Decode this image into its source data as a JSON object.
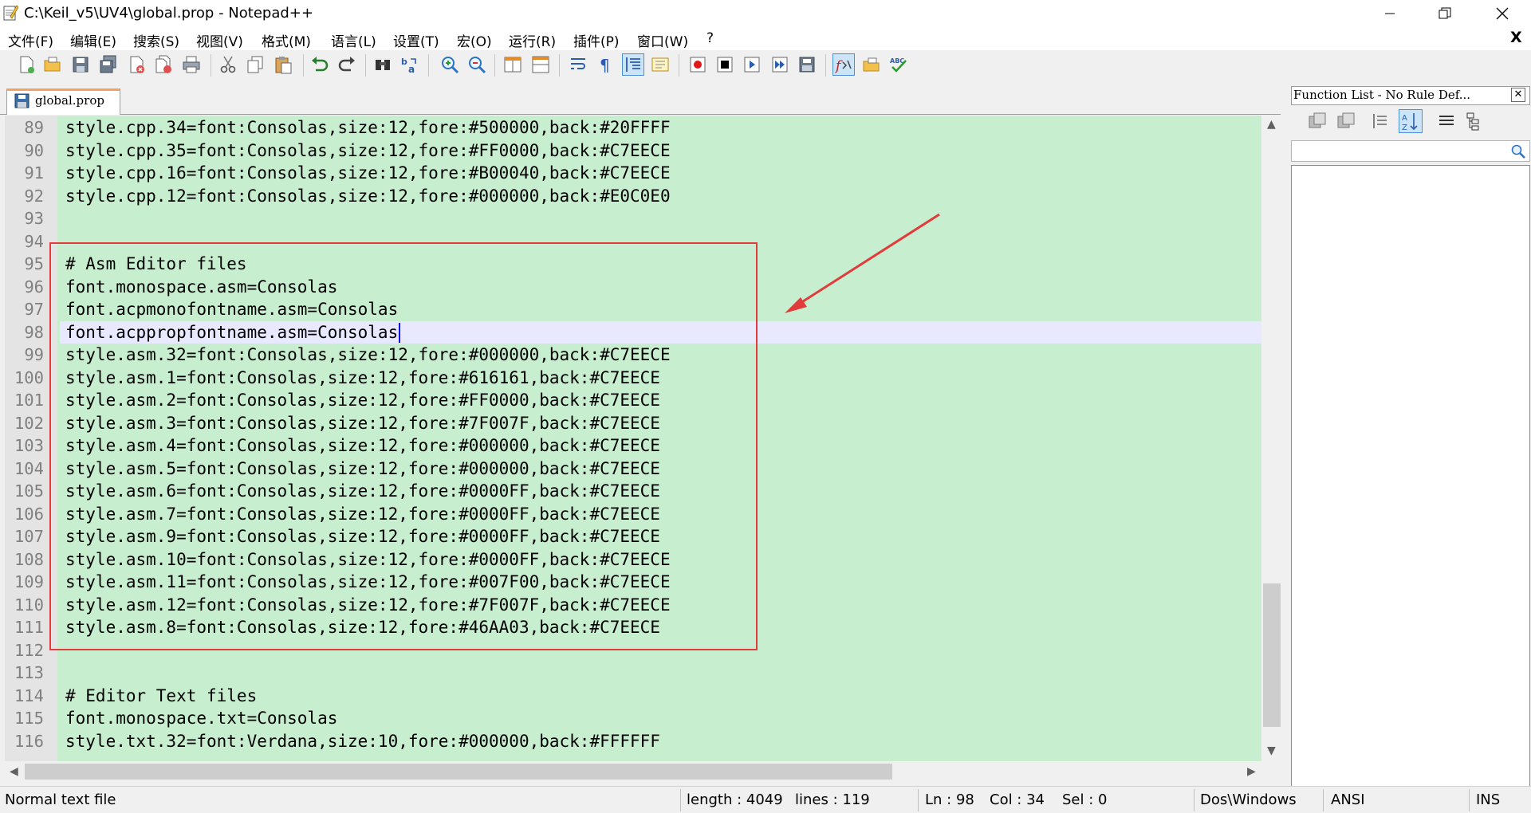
{
  "window": {
    "title": "C:\\Keil_v5\\UV4\\global.prop - Notepad++",
    "minimize_icon": "minimize-icon",
    "maximize_icon": "restore-icon",
    "close_icon": "close-icon"
  },
  "menu": {
    "items": [
      "文件(F)",
      "编辑(E)",
      "搜索(S)",
      "视图(V)",
      "格式(M)",
      "语言(L)",
      "设置(T)",
      "宏(O)",
      "运行(R)",
      "插件(P)",
      "窗口(W)",
      "?"
    ],
    "close_doc": "X"
  },
  "toolbar": {
    "icons": [
      "new-file-icon",
      "open-file-icon",
      "save-icon",
      "save-all-icon",
      "close-icon",
      "close-all-icon",
      "print-icon",
      "cut-icon",
      "copy-icon",
      "paste-icon",
      "undo-icon",
      "redo-icon",
      "find-icon",
      "replace-icon",
      "zoom-in-icon",
      "zoom-out-icon",
      "sync-vertical-icon",
      "sync-horizontal-icon",
      "word-wrap-icon",
      "show-all-chars-icon",
      "indent-guide-icon",
      "doc-map-icon",
      "record-macro-icon",
      "stop-macro-icon",
      "play-macro-icon",
      "run-macro-multiple-icon",
      "save-macro-icon",
      "function-list-icon",
      "folder-as-workspace-icon",
      "spell-check-icon"
    ]
  },
  "tab": {
    "label": "global.prop",
    "icon": "saved-file-icon"
  },
  "editor": {
    "background": "#C7EECE",
    "current_line": 98,
    "caret_col": 34,
    "lines": [
      {
        "n": "89",
        "text": "style.cpp.34=font:Consolas,size:12,fore:#500000,back:#20FFFF"
      },
      {
        "n": "90",
        "text": "style.cpp.35=font:Consolas,size:12,fore:#FF0000,back:#C7EECE"
      },
      {
        "n": "91",
        "text": "style.cpp.16=font:Consolas,size:12,fore:#B00040,back:#C7EECE"
      },
      {
        "n": "92",
        "text": "style.cpp.12=font:Consolas,size:12,fore:#000000,back:#E0C0E0"
      },
      {
        "n": "93",
        "text": ""
      },
      {
        "n": "94",
        "text": ""
      },
      {
        "n": "95",
        "text": "# Asm Editor files"
      },
      {
        "n": "96",
        "text": "font.monospace.asm=Consolas"
      },
      {
        "n": "97",
        "text": "font.acpmonofontname.asm=Consolas"
      },
      {
        "n": "98",
        "text": "font.acppropfontname.asm=Consolas"
      },
      {
        "n": "99",
        "text": "style.asm.32=font:Consolas,size:12,fore:#000000,back:#C7EECE"
      },
      {
        "n": "100",
        "text": "style.asm.1=font:Consolas,size:12,fore:#616161,back:#C7EECE"
      },
      {
        "n": "101",
        "text": "style.asm.2=font:Consolas,size:12,fore:#FF0000,back:#C7EECE"
      },
      {
        "n": "102",
        "text": "style.asm.3=font:Consolas,size:12,fore:#7F007F,back:#C7EECE"
      },
      {
        "n": "103",
        "text": "style.asm.4=font:Consolas,size:12,fore:#000000,back:#C7EECE"
      },
      {
        "n": "104",
        "text": "style.asm.5=font:Consolas,size:12,fore:#000000,back:#C7EECE"
      },
      {
        "n": "105",
        "text": "style.asm.6=font:Consolas,size:12,fore:#0000FF,back:#C7EECE"
      },
      {
        "n": "106",
        "text": "style.asm.7=font:Consolas,size:12,fore:#0000FF,back:#C7EECE"
      },
      {
        "n": "107",
        "text": "style.asm.9=font:Consolas,size:12,fore:#0000FF,back:#C7EECE"
      },
      {
        "n": "108",
        "text": "style.asm.10=font:Consolas,size:12,fore:#0000FF,back:#C7EECE"
      },
      {
        "n": "109",
        "text": "style.asm.11=font:Consolas,size:12,fore:#007F00,back:#C7EECE"
      },
      {
        "n": "110",
        "text": "style.asm.12=font:Consolas,size:12,fore:#7F007F,back:#C7EECE"
      },
      {
        "n": "111",
        "text": "style.asm.8=font:Consolas,size:12,fore:#46AA03,back:#C7EECE"
      },
      {
        "n": "112",
        "text": ""
      },
      {
        "n": "113",
        "text": ""
      },
      {
        "n": "114",
        "text": "# Editor Text files"
      },
      {
        "n": "115",
        "text": "font.monospace.txt=Consolas"
      },
      {
        "n": "116",
        "text": "style.txt.32=font:Verdana,size:10,fore:#000000,back:#FFFFFF"
      }
    ]
  },
  "function_list": {
    "title": "Function List - No Rule Def...",
    "close": "✕",
    "icons": [
      "sort-desc-icon",
      "sort-asc-icon",
      "collapse-icon",
      "sort-alpha-icon",
      "list-icon",
      "tree-icon"
    ],
    "search_icon": "magnifier-icon"
  },
  "status": {
    "file_type": "Normal text file",
    "length": "length : 4049",
    "lines": "lines : 119",
    "ln": "Ln : 98",
    "col": "Col : 34",
    "sel": "Sel : 0",
    "eol": "Dos\\Windows",
    "encoding": "ANSI",
    "mode": "INS"
  },
  "annotation": {
    "color": "#E23B3B"
  }
}
